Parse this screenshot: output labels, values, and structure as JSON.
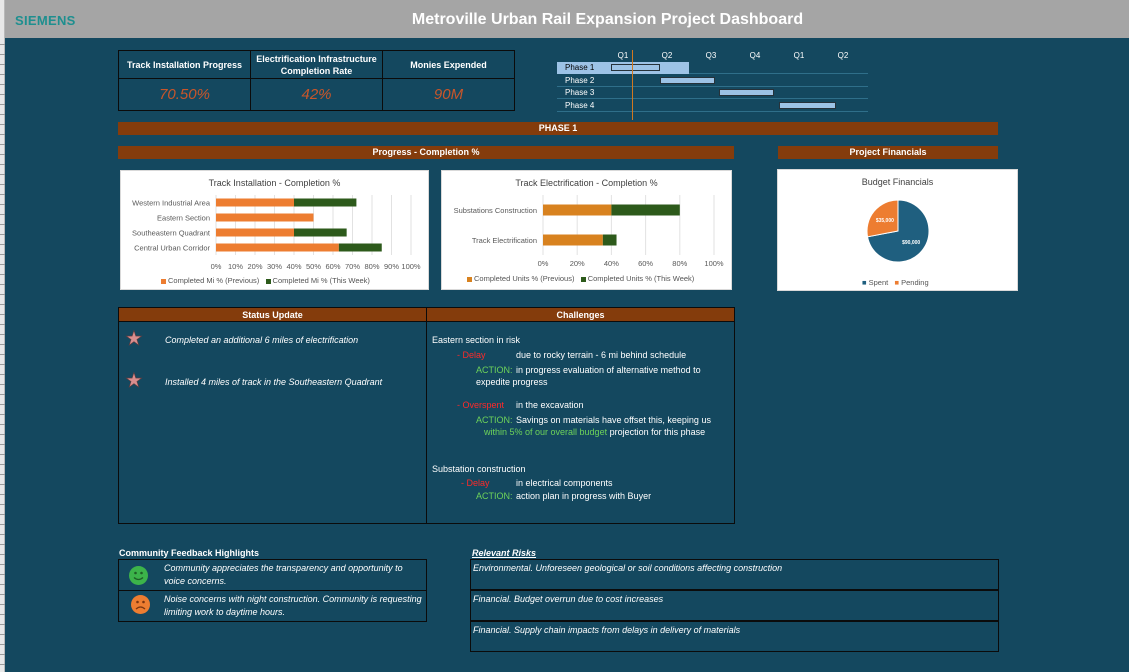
{
  "header": {
    "logo": "SIEMENS",
    "title": "Metroville Urban Rail Expansion Project Dashboard"
  },
  "kpis": [
    {
      "label": "Track Installation Progress",
      "value": "70.50%"
    },
    {
      "label": "Electrification Infrastructure Completion Rate",
      "value": "42%"
    },
    {
      "label": "Monies Expended",
      "value": "90M"
    }
  ],
  "gantt": {
    "quarters": [
      "Q1",
      "Q2",
      "Q3",
      "Q4",
      "Q1",
      "Q2"
    ],
    "phases": [
      {
        "label": "Phase 1",
        "start": 0.1,
        "end": 1.2,
        "highlight": true
      },
      {
        "label": "Phase 2",
        "start": 1.2,
        "end": 2.45
      },
      {
        "label": "Phase 3",
        "start": 2.55,
        "end": 3.8
      },
      {
        "label": "Phase 4",
        "start": 3.9,
        "end": 5.2
      }
    ]
  },
  "sections": {
    "phase": "PHASE 1",
    "progress": "Progress - Completion %",
    "financials": "Project Financials"
  },
  "chart_data": [
    {
      "type": "bar",
      "orientation": "horizontal",
      "stacked": true,
      "title": "Track Installation - Completion %",
      "categories": [
        "Western Industrial Area",
        "Eastern Section",
        "Southeastern Quadrant",
        "Central Urban Corridor"
      ],
      "series": [
        {
          "name": "Completed Mi % (Previous)",
          "color": "#ed7d31",
          "values": [
            40,
            50,
            40,
            63
          ]
        },
        {
          "name": "Completed Mi % (This Week)",
          "color": "#2d5a1b",
          "values": [
            32,
            0,
            27,
            22
          ]
        }
      ],
      "xlim": [
        0,
        100
      ],
      "xticks": [
        "0%",
        "10%",
        "20%",
        "30%",
        "40%",
        "50%",
        "60%",
        "70%",
        "80%",
        "90%",
        "100%"
      ],
      "grid": true,
      "legend": "bottom"
    },
    {
      "type": "bar",
      "orientation": "horizontal",
      "stacked": true,
      "title": "Track Electrification - Completion %",
      "categories": [
        "Substations Construction",
        "Track Electrification"
      ],
      "series": [
        {
          "name": "Completed Units % (Previous)",
          "color": "#d8821f",
          "values": [
            40,
            35
          ]
        },
        {
          "name": "Completed Units % (This Week)",
          "color": "#2d5a1b",
          "values": [
            40,
            8
          ]
        }
      ],
      "xlim": [
        0,
        100
      ],
      "xticks": [
        "0%",
        "20%",
        "40%",
        "60%",
        "80%",
        "100%"
      ],
      "grid": true,
      "legend": "bottom"
    },
    {
      "type": "pie",
      "title": "Budget Financials",
      "slices": [
        {
          "name": "Spent",
          "color": "#1f5f7f",
          "value": 90000,
          "label": "$90,000"
        },
        {
          "name": "Pending",
          "color": "#ed7d31",
          "value": 35000,
          "label": "$35,000"
        }
      ],
      "legend": "bottom"
    }
  ],
  "status": {
    "title": "Status Update",
    "items": [
      "Completed  an additional 6 miles of  electrification",
      "Installed 4 miles of track in the Southeastern  Quadrant"
    ]
  },
  "challenges": {
    "title": "Challenges",
    "eastern_heading": "Eastern section in risk",
    "delay1_tag": "- Delay",
    "delay1_text": "due to rocky terrain - 6 mi behind schedule",
    "action_tag": "ACTION:",
    "action1_line1": "in progress evaluation of alternative method to",
    "action1_line2": "expedite progress",
    "overspent_tag": "- Overspent",
    "overspent_text": "in the excavation",
    "action2_line1": "Savings on materials have offset this, keeping us",
    "action2_line2_green": "within 5% of our overall budget",
    "action2_line2_rest": " projection for this phase",
    "substation_heading": "Substation construction",
    "delay2_tag": "- Delay",
    "delay2_text": "in electrical components",
    "action3_text": "action plan in progress with Buyer"
  },
  "feedback": {
    "title": "Community Feedback Highlights",
    "items": [
      {
        "mood": "positive",
        "color": "#3cb34a",
        "text": "Community appreciates the transparency and opportunity to voice concerns."
      },
      {
        "mood": "negative",
        "color": "#ed7d31",
        "text": "Noise concerns with night construction.  Community is requesting limiting work to daytime hours."
      }
    ]
  },
  "risks": {
    "title": "Relevant Risks",
    "items": [
      "Environmental.  Unforeseen geological or soil conditions affecting construction",
      "Financial.  Budget overrun due to  cost increases",
      "Financial.  Supply chain impacts from delays in delivery of materials"
    ]
  }
}
